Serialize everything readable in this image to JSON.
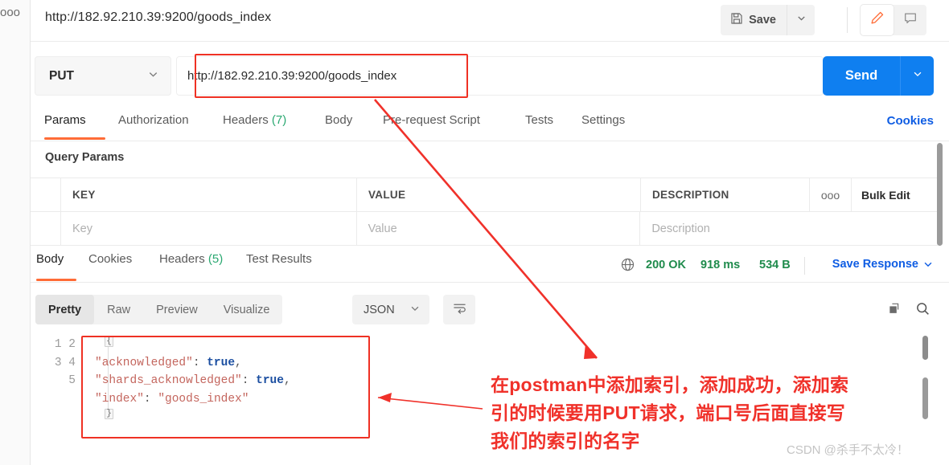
{
  "window": {
    "request_title": "http://182.92.210.39:9200/goods_index",
    "rail_dots": "ooo"
  },
  "toolbar": {
    "save_label": "Save",
    "save_icon": "floppy-disk-icon",
    "save_caret_icon": "chevron-down-icon",
    "edit_icon": "pencil-icon",
    "comment_icon": "comment-icon"
  },
  "url_bar": {
    "method": "PUT",
    "method_caret_icon": "chevron-down-icon",
    "url": "http://182.92.210.39:9200/goods_index",
    "send_label": "Send",
    "send_caret_icon": "chevron-down-icon",
    "highlight_color": "#ef3124"
  },
  "request_tabs": {
    "items": [
      {
        "label": "Params",
        "count": "",
        "active": true
      },
      {
        "label": "Authorization",
        "count": "",
        "active": false
      },
      {
        "label": "Headers",
        "count": "(7)",
        "active": false
      },
      {
        "label": "Body",
        "count": "",
        "active": false
      },
      {
        "label": "Pre-request Script",
        "count": "",
        "active": false
      },
      {
        "label": "Tests",
        "count": "",
        "active": false
      },
      {
        "label": "Settings",
        "count": "",
        "active": false
      }
    ],
    "cookies_label": "Cookies"
  },
  "query_params": {
    "section_label": "Query Params",
    "headers": [
      "KEY",
      "VALUE",
      "DESCRIPTION"
    ],
    "more_icon": "ooo",
    "bulk_edit_label": "Bulk Edit",
    "row_placeholders": [
      "Key",
      "Value",
      "Description"
    ]
  },
  "response_tabs": {
    "items": [
      {
        "label": "Body",
        "count": "",
        "active": true
      },
      {
        "label": "Cookies",
        "count": "",
        "active": false
      },
      {
        "label": "Headers",
        "count": "(5)",
        "active": false
      },
      {
        "label": "Test Results",
        "count": "",
        "active": false
      }
    ],
    "globe_icon": "globe-icon",
    "status": "200 OK",
    "time": "918 ms",
    "size": "534 B",
    "save_response_label": "Save Response",
    "save_response_caret_icon": "chevron-down-icon"
  },
  "response_toolbar": {
    "views": [
      {
        "label": "Pretty",
        "active": true
      },
      {
        "label": "Raw",
        "active": false
      },
      {
        "label": "Preview",
        "active": false
      },
      {
        "label": "Visualize",
        "active": false
      }
    ],
    "format": "JSON",
    "format_caret_icon": "chevron-down-icon",
    "wrap_icon": "word-wrap-icon",
    "copy_icon": "copy-icon",
    "search_icon": "search-icon"
  },
  "response_body": {
    "line_numbers": [
      "1",
      "2",
      "3",
      "4",
      "5"
    ],
    "lines": [
      {
        "indent": 0,
        "text": "{",
        "type": "brace"
      },
      {
        "indent": 1,
        "key": "\"acknowledged\"",
        "value": "true",
        "value_type": "boolean",
        "comma": true
      },
      {
        "indent": 1,
        "key": "\"shards_acknowledged\"",
        "value": "true",
        "value_type": "boolean",
        "comma": true
      },
      {
        "indent": 1,
        "key": "\"index\"",
        "value": "\"goods_index\"",
        "value_type": "string",
        "comma": false
      },
      {
        "indent": 0,
        "text": "}",
        "type": "brace"
      }
    ],
    "highlight_color": "#ef3124"
  },
  "annotation": {
    "line1": "在postman中添加索引，添加成功，添加索",
    "line2": "引的时候要用PUT请求，端口号后面直接写",
    "line3": "我们的索引的名字",
    "color": "#f0312a",
    "watermark": "CSDN @杀手不太冷！"
  }
}
